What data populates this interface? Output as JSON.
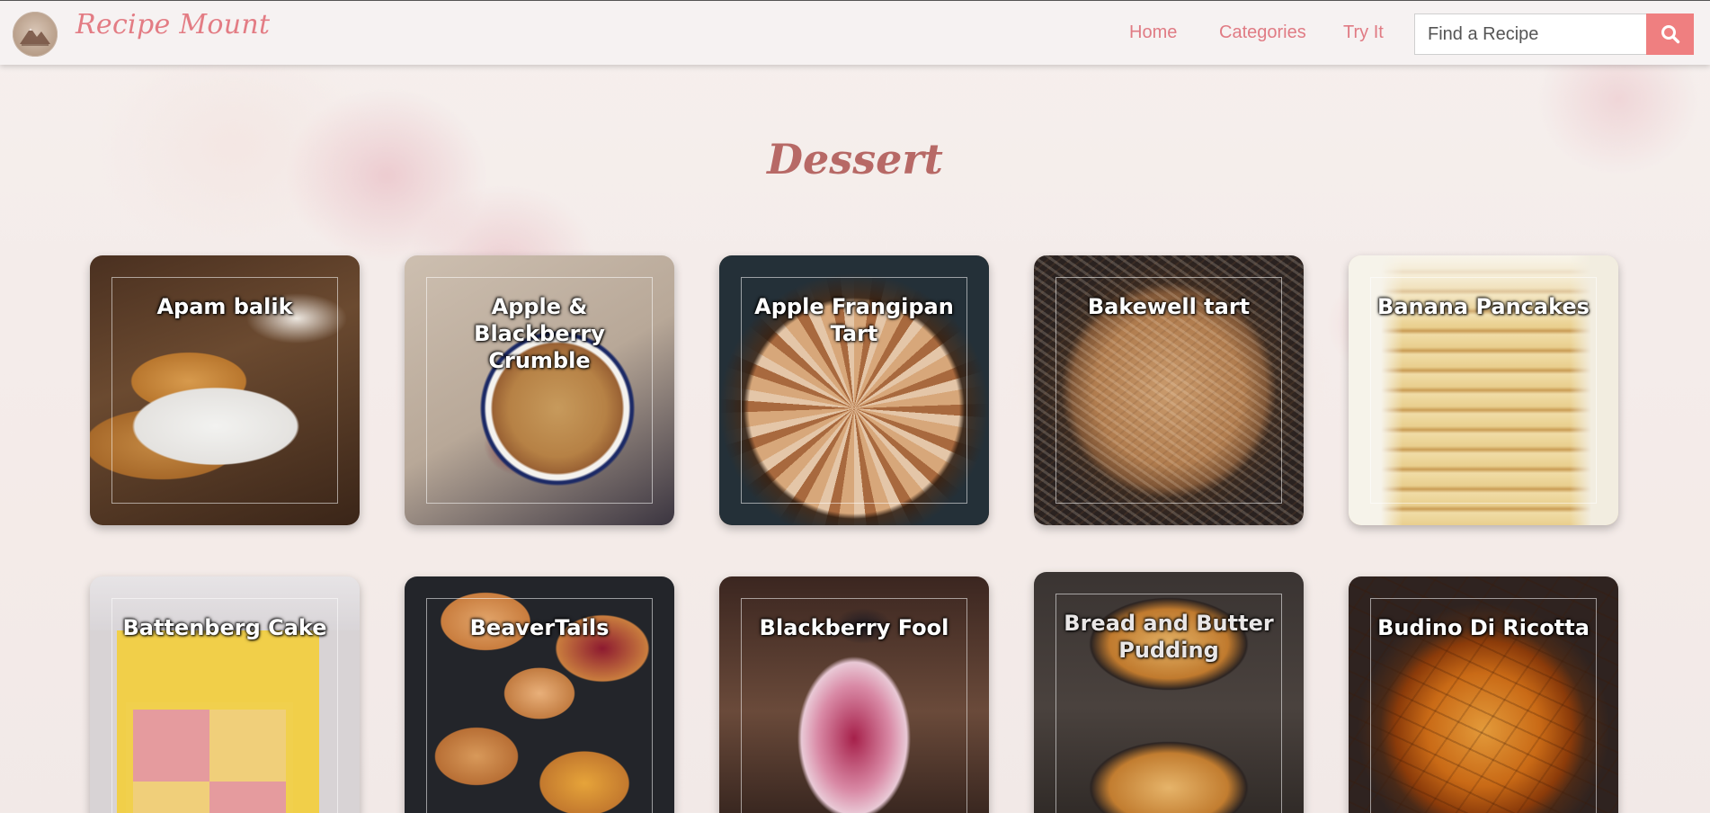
{
  "brand": {
    "name": "Recipe Mount",
    "logo_icon": "mountain-logo-icon"
  },
  "nav": {
    "links": [
      "Home",
      "Categories",
      "Try It"
    ]
  },
  "search": {
    "placeholder": "Find a Recipe",
    "value": "",
    "button_icon": "search-icon",
    "button_color": "#ef7f80"
  },
  "page": {
    "title": "Dessert"
  },
  "recipes": [
    {
      "name": "Apam balik"
    },
    {
      "name": "Apple & Blackberry Crumble"
    },
    {
      "name": "Apple Frangipan Tart"
    },
    {
      "name": "Bakewell tart"
    },
    {
      "name": "Banana Pancakes"
    },
    {
      "name": "Battenberg Cake"
    },
    {
      "name": "BeaverTails"
    },
    {
      "name": "Blackberry Fool"
    },
    {
      "name": "Bread and Butter Pudding"
    },
    {
      "name": "Budino Di Ricotta"
    }
  ],
  "colors": {
    "accent": "#e07b84",
    "title": "#b76966",
    "navbar_bg": "#f6f2f2"
  }
}
